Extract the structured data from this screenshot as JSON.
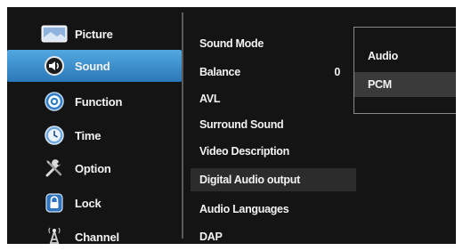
{
  "sidebar": {
    "items": [
      {
        "label": "Picture",
        "icon": "picture-icon"
      },
      {
        "label": "Sound",
        "icon": "sound-icon"
      },
      {
        "label": "Function",
        "icon": "function-icon"
      },
      {
        "label": "Time",
        "icon": "time-icon"
      },
      {
        "label": "Option",
        "icon": "option-icon"
      },
      {
        "label": "Lock",
        "icon": "lock-icon"
      },
      {
        "label": "Channel",
        "icon": "channel-icon"
      }
    ],
    "active_index": 1,
    "active_color": "#3a90d0"
  },
  "sound_menu": {
    "items": [
      {
        "label": "Sound Mode",
        "value": ""
      },
      {
        "label": "Balance",
        "value": "0"
      },
      {
        "label": "AVL",
        "value": ""
      },
      {
        "label": "Surround Sound",
        "value": ""
      },
      {
        "label": "Video Description",
        "value": ""
      },
      {
        "label": "Digital Audio output",
        "value": ""
      },
      {
        "label": "Audio Languages",
        "value": ""
      },
      {
        "label": "DAP",
        "value": ""
      }
    ],
    "selected_index": 5
  },
  "digital_audio_popup": {
    "options": [
      "Audio",
      "PCM"
    ],
    "selected_index": 1
  }
}
